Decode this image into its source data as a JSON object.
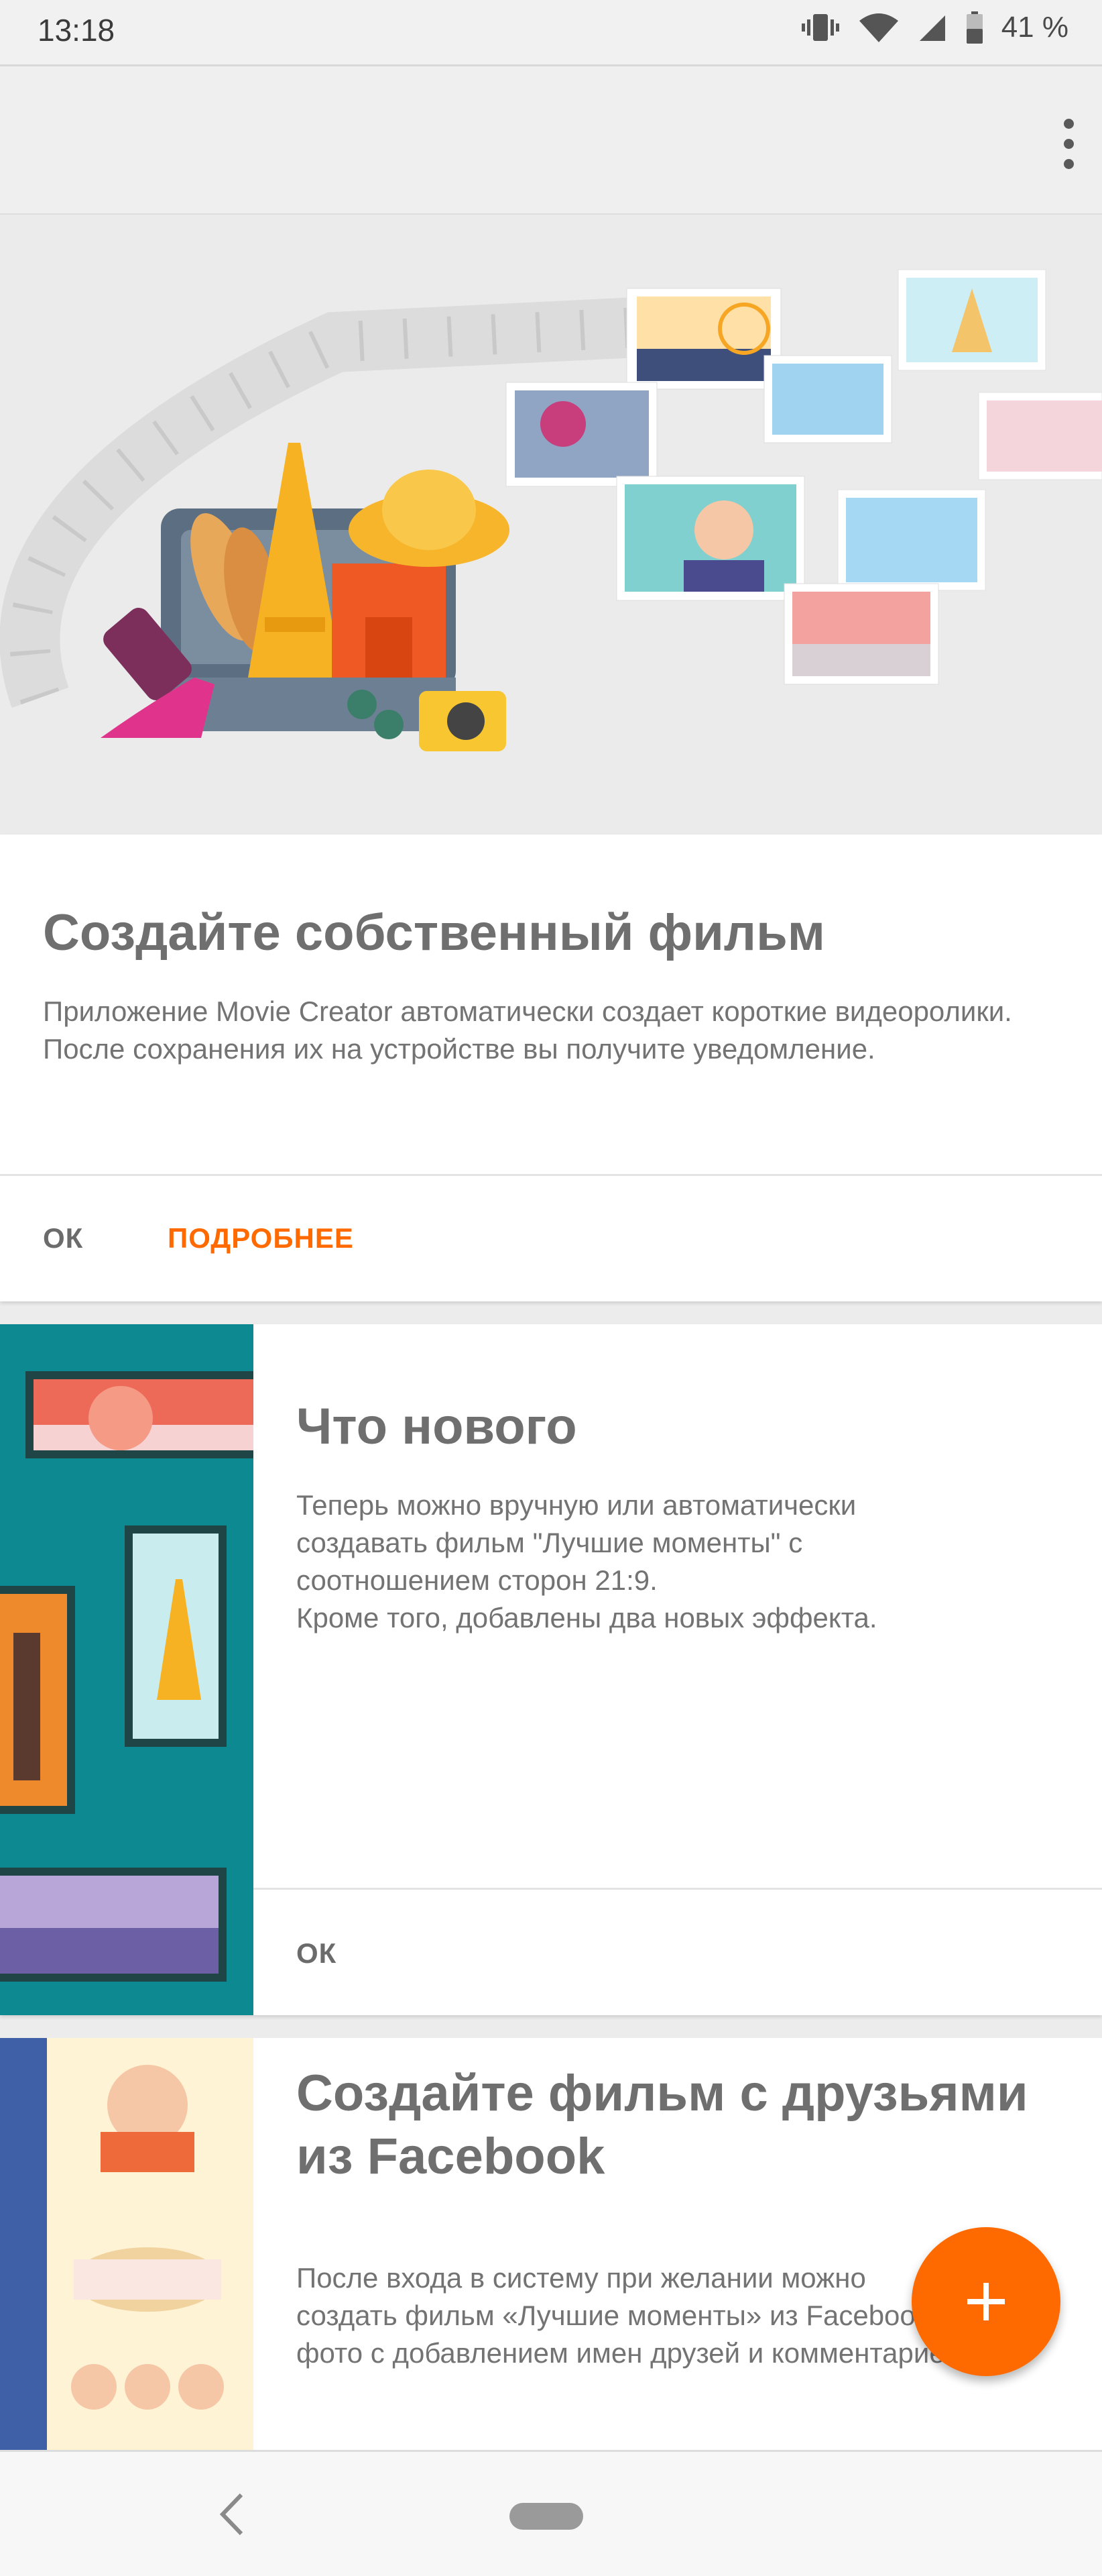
{
  "status_bar": {
    "time": "13:18",
    "battery": "41 %",
    "icons": [
      "vibrate-icon",
      "wifi-icon",
      "signal-icon",
      "battery-icon"
    ]
  },
  "toolbar": {
    "menu_icon": "more-vert-icon"
  },
  "cards": [
    {
      "title": "Создайте собственный фильм",
      "text": "Приложение Movie Creator автоматически создает короткие видеоролики. После сохранения их на устройстве вы получите уведомление.",
      "actions": [
        "ОК",
        "ПОДРОБНЕЕ"
      ]
    },
    {
      "title": "Что нового",
      "text_lines": [
        "Теперь можно вручную или автоматически",
        "создавать фильм \"Лучшие моменты\" с",
        "соотношением сторон 21:9.",
        "Кроме того, добавлены два новых эффекта."
      ],
      "actions": [
        "ОК"
      ]
    },
    {
      "title_lines": [
        "Создайте фильм с друзьями",
        "из Facebook"
      ],
      "text_lines": [
        "После входа в систему при желании можно",
        "создать фильм «Лучшие моменты» из Facebook",
        "фото с добавлением имен друзей и комментариев."
      ]
    }
  ],
  "fab": {
    "icon": "plus-icon"
  },
  "nav_bar": {
    "icons": [
      "back-icon",
      "home-pill-icon"
    ]
  },
  "colors": {
    "accent": "#ff6a00",
    "teal": "#0d8a91",
    "text": "#6f6f6f"
  }
}
